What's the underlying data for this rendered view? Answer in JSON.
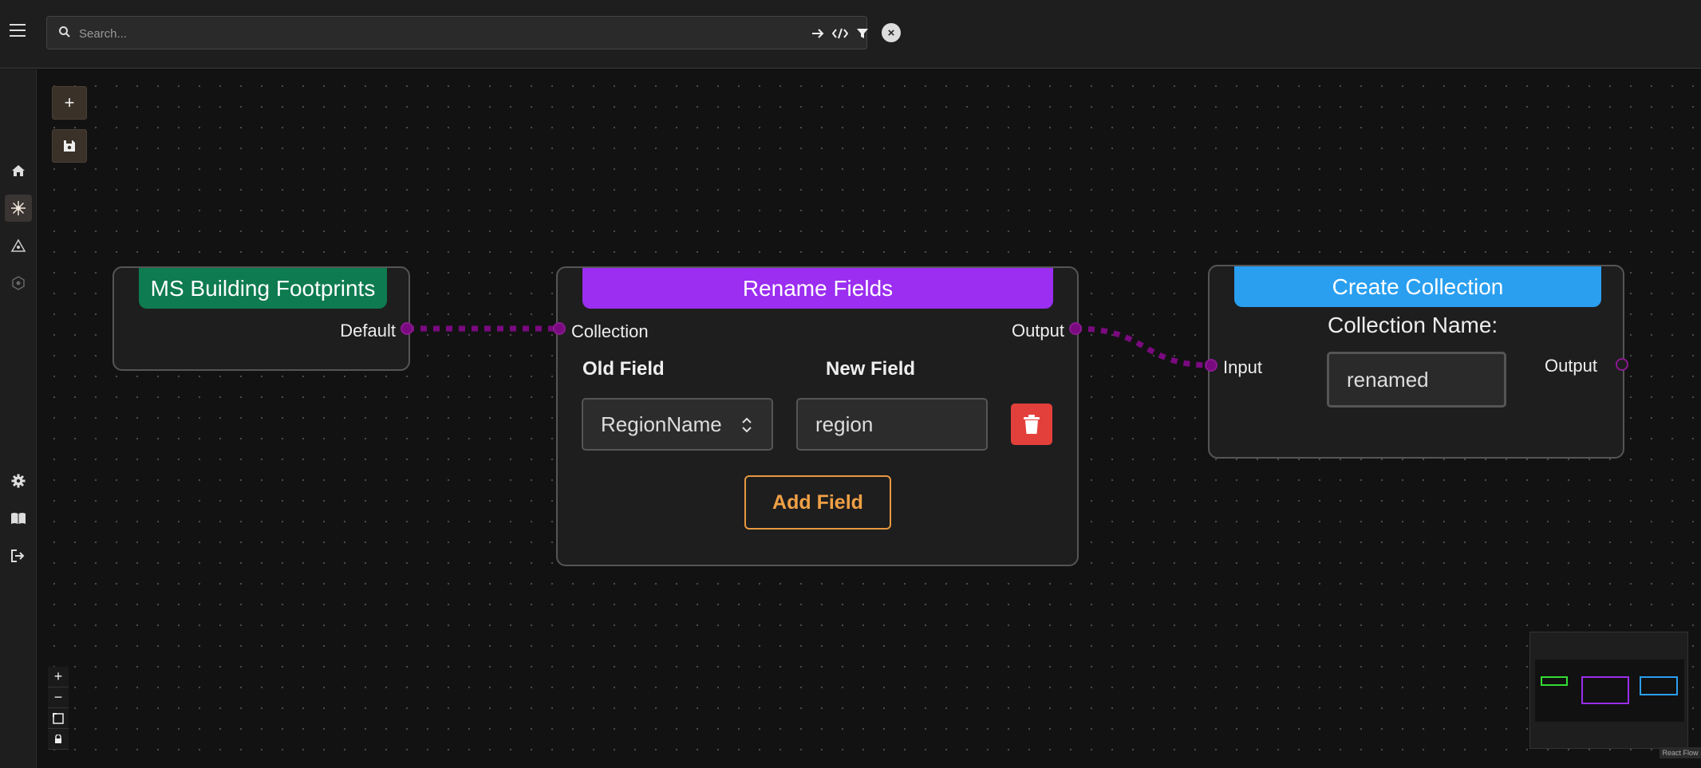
{
  "search": {
    "placeholder": "Search..."
  },
  "toolbar": {
    "add_label": "+",
    "clear_label": "×"
  },
  "nodes": {
    "source": {
      "title": "MS Building Footprints",
      "title_color": "#0e7b50",
      "output_label": "Default"
    },
    "rename": {
      "title": "Rename Fields",
      "title_color": "#9b2ef0",
      "input_label": "Collection",
      "output_label": "Output",
      "old_field_header": "Old Field",
      "new_field_header": "New Field",
      "old_field_value": "RegionName",
      "new_field_value": "region",
      "add_field_label": "Add Field"
    },
    "create": {
      "title": "Create Collection",
      "title_color": "#2a9ff0",
      "input_label": "Input",
      "output_label": "Output",
      "collection_name_label": "Collection Name:",
      "collection_name_value": "renamed"
    }
  },
  "zoom_controls": {
    "zoom_in": "+",
    "zoom_out": "−"
  },
  "attribution": "React Flow",
  "colors": {
    "edge": "#7a0a7f",
    "accent_add_field": "#e8983f",
    "delete": "#e4403b"
  }
}
